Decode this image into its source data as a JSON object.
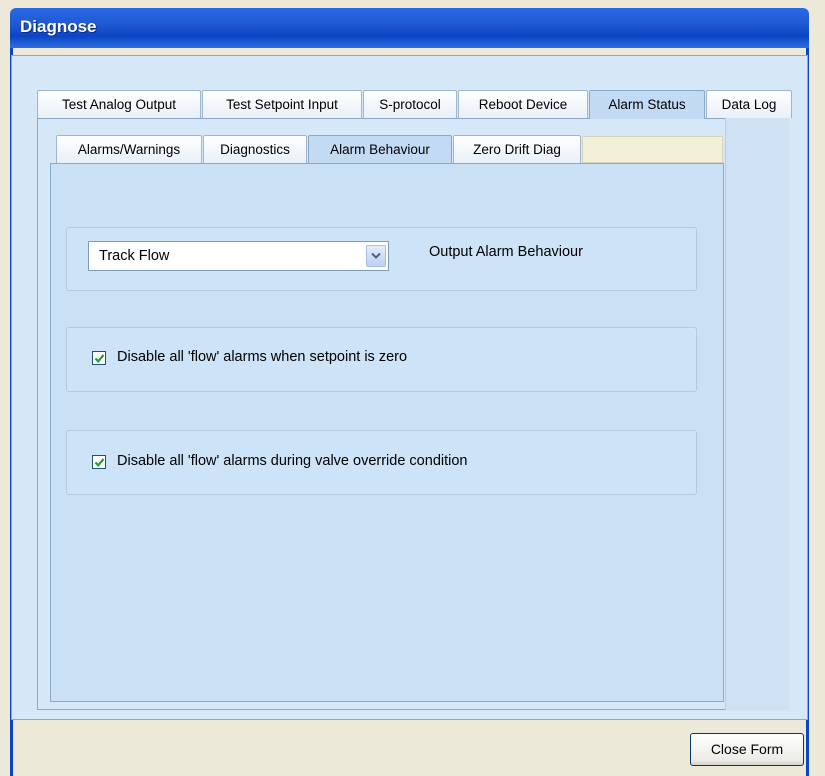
{
  "window": {
    "title": "Diagnose"
  },
  "outer_tabs": [
    {
      "label": "Test Analog Output",
      "active": false
    },
    {
      "label": "Test Setpoint Input",
      "active": false
    },
    {
      "label": "S-protocol",
      "active": false
    },
    {
      "label": "Reboot Device",
      "active": false
    },
    {
      "label": "Alarm Status",
      "active": true
    },
    {
      "label": "Data Log",
      "active": false
    }
  ],
  "inner_tabs": [
    {
      "label": "Alarms/Warnings",
      "active": false
    },
    {
      "label": "Diagnostics",
      "active": false
    },
    {
      "label": "Alarm Behaviour",
      "active": true
    },
    {
      "label": "Zero Drift Diag",
      "active": false
    }
  ],
  "alarm_behaviour": {
    "output_select": {
      "value": "Track Flow",
      "label": "Output Alarm Behaviour"
    },
    "disable_setpoint_zero": {
      "checked": true,
      "label": "Disable all 'flow' alarms when setpoint is zero"
    },
    "disable_valve_override": {
      "checked": true,
      "label": "Disable all 'flow' alarms during valve override condition"
    }
  },
  "footer": {
    "close_label": "Close Form"
  },
  "colors": {
    "title_bar": "#0b44c6",
    "active_tab": "#c2dbf3",
    "panel": "#c9e0f5",
    "check_mark": "#21a121"
  },
  "icons": {
    "dropdown": "chevron-down-icon",
    "checkbox": "checkmark-icon"
  }
}
